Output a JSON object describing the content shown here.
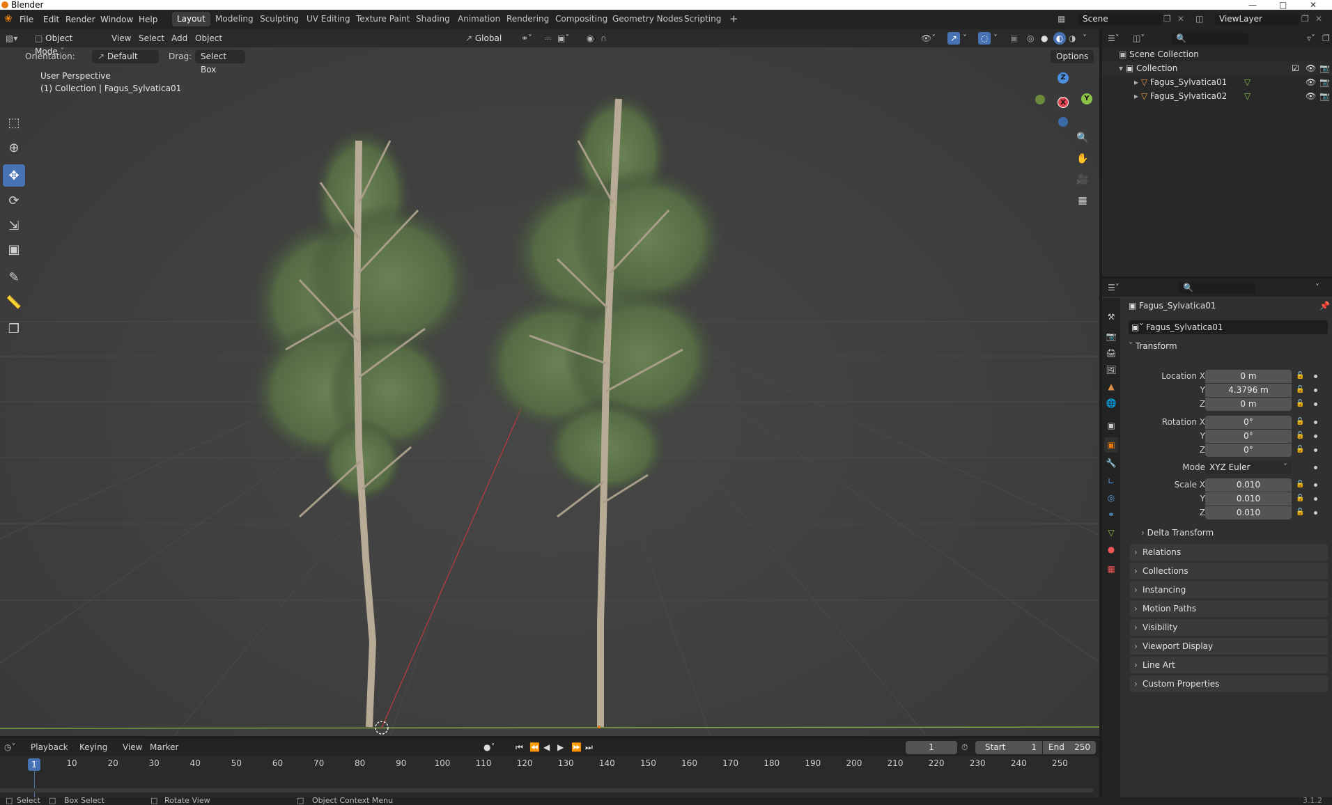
{
  "window": {
    "title": "Blender"
  },
  "menu": {
    "file": "File",
    "edit": "Edit",
    "render": "Render",
    "window": "Window",
    "help": "Help"
  },
  "workspaces": [
    "Layout",
    "Modeling",
    "Sculpting",
    "UV Editing",
    "Texture Paint",
    "Shading",
    "Animation",
    "Rendering",
    "Compositing",
    "Geometry Nodes",
    "Scripting"
  ],
  "active_workspace": "Layout",
  "scene": {
    "name": "Scene",
    "view_layer": "ViewLayer"
  },
  "viewport_header": {
    "mode": "Object Mode",
    "view": "View",
    "select": "Select",
    "add": "Add",
    "object": "Object",
    "transform_orientation": "Global",
    "orientation_label": "Orientation:",
    "orientation_value": "Default",
    "drag_label": "Drag:",
    "drag_value": "Select Box",
    "options": "Options"
  },
  "viewport_overlay": {
    "perspective": "User Perspective",
    "collection_info": "(1) Collection | Fagus_Sylvatica01"
  },
  "gizmo": {
    "z": "Z",
    "x": "X",
    "y": "Y"
  },
  "outliner": {
    "root": "Scene Collection",
    "collection": "Collection",
    "objects": [
      "Fagus_Sylvatica01",
      "Fagus_Sylvatica02"
    ]
  },
  "properties": {
    "object_name": "Fagus_Sylvatica01",
    "object_field": "Fagus_Sylvatica01",
    "transform_title": "Transform",
    "location": {
      "label": "Location X",
      "x": "0 m",
      "y": "4.3796 m",
      "z": "0 m"
    },
    "rotation": {
      "label": "Rotation X",
      "x": "0°",
      "y": "0°",
      "z": "0°"
    },
    "mode": {
      "label": "Mode",
      "value": "XYZ Euler"
    },
    "scale": {
      "label": "Scale X",
      "x": "0.010",
      "y": "0.010",
      "z": "0.010"
    },
    "axis_y": "Y",
    "axis_z": "Z",
    "delta_transform": "Delta Transform",
    "panels": [
      "Relations",
      "Collections",
      "Instancing",
      "Motion Paths",
      "Visibility",
      "Viewport Display",
      "Line Art",
      "Custom Properties"
    ]
  },
  "timeline": {
    "playback": "Playback",
    "keying": "Keying",
    "view": "View",
    "marker": "Marker",
    "current_frame": "1",
    "start_label": "Start",
    "start": "1",
    "end_label": "End",
    "end": "250",
    "playhead": "1",
    "ticks": [
      "10",
      "20",
      "30",
      "40",
      "50",
      "60",
      "70",
      "80",
      "90",
      "100",
      "110",
      "120",
      "130",
      "140",
      "150",
      "160",
      "170",
      "180",
      "190",
      "200",
      "210",
      "220",
      "230",
      "240",
      "250"
    ]
  },
  "statusbar": {
    "select": "Select",
    "box_select": "Box Select",
    "rotate_view": "Rotate View",
    "context_menu": "Object Context Menu",
    "version": "3.1.2"
  },
  "colors": {
    "accent": "#4772b3",
    "x_axis": "#e54553",
    "y_axis": "#8bc34a",
    "z_axis": "#4a8fe0",
    "foliage": "#5a7246"
  }
}
